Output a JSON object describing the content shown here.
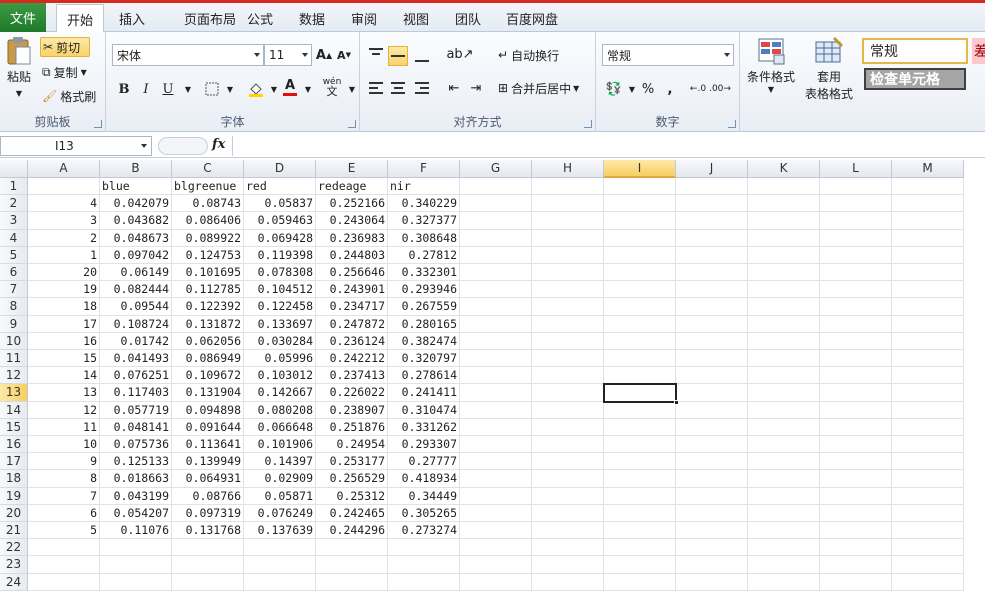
{
  "tabs": {
    "file": "文件",
    "items": [
      "开始",
      "插入",
      "页面布局",
      "公式",
      "数据",
      "审阅",
      "视图",
      "团队",
      "百度网盘"
    ]
  },
  "ribbon": {
    "clipboard": {
      "label": "剪贴板",
      "paste": "粘贴",
      "cut": "剪切",
      "copy": "复制",
      "format_painter": "格式刷"
    },
    "font": {
      "label": "字体",
      "name": "宋体",
      "size": "11",
      "bold": "B",
      "italic": "I",
      "underline": "U",
      "wen": "wén"
    },
    "alignment": {
      "label": "对齐方式",
      "wrap": "自动换行",
      "merge": "合并后居中"
    },
    "number": {
      "label": "数字",
      "format": "常规",
      "percent": "%",
      "comma": ","
    },
    "styles": {
      "conditional": "条件格式",
      "table_line1": "套用",
      "table_line2": "表格格式",
      "style_normal": "常规",
      "style_check": "检查单元格",
      "style_bad": "差"
    }
  },
  "formula_bar": {
    "name_box": "I13",
    "fx": "fx",
    "content": ""
  },
  "colors": {
    "accent_red": "#d52b1e",
    "file_green": "#2a8a35",
    "selection_gold": "#f7cf60"
  },
  "columns": [
    "A",
    "B",
    "C",
    "D",
    "E",
    "F",
    "G",
    "H",
    "I",
    "J",
    "K",
    "L",
    "M"
  ],
  "rows": [
    "1",
    "2",
    "3",
    "4",
    "5",
    "6",
    "7",
    "8",
    "9",
    "10",
    "11",
    "12",
    "13",
    "14",
    "15",
    "16",
    "17",
    "18",
    "19",
    "20",
    "21",
    "22",
    "23",
    "24"
  ],
  "sheet": {
    "header": [
      "",
      "blue",
      "blgreenue",
      "red",
      "redeage",
      "nir"
    ],
    "data": [
      [
        "4",
        "0.042079",
        "0.08743",
        "0.05837",
        "0.252166",
        "0.340229"
      ],
      [
        "3",
        "0.043682",
        "0.086406",
        "0.059463",
        "0.243064",
        "0.327377"
      ],
      [
        "2",
        "0.048673",
        "0.089922",
        "0.069428",
        "0.236983",
        "0.308648"
      ],
      [
        "1",
        "0.097042",
        "0.124753",
        "0.119398",
        "0.244803",
        "0.27812"
      ],
      [
        "20",
        "0.06149",
        "0.101695",
        "0.078308",
        "0.256646",
        "0.332301"
      ],
      [
        "19",
        "0.082444",
        "0.112785",
        "0.104512",
        "0.243901",
        "0.293946"
      ],
      [
        "18",
        "0.09544",
        "0.122392",
        "0.122458",
        "0.234717",
        "0.267559"
      ],
      [
        "17",
        "0.108724",
        "0.131872",
        "0.133697",
        "0.247872",
        "0.280165"
      ],
      [
        "16",
        "0.01742",
        "0.062056",
        "0.030284",
        "0.236124",
        "0.382474"
      ],
      [
        "15",
        "0.041493",
        "0.086949",
        "0.05996",
        "0.242212",
        "0.320797"
      ],
      [
        "14",
        "0.076251",
        "0.109672",
        "0.103012",
        "0.237413",
        "0.278614"
      ],
      [
        "13",
        "0.117403",
        "0.131904",
        "0.142667",
        "0.226022",
        "0.241411"
      ],
      [
        "12",
        "0.057719",
        "0.094898",
        "0.080208",
        "0.238907",
        "0.310474"
      ],
      [
        "11",
        "0.048141",
        "0.091644",
        "0.066648",
        "0.251876",
        "0.331262"
      ],
      [
        "10",
        "0.075736",
        "0.113641",
        "0.101906",
        "0.24954",
        "0.293307"
      ],
      [
        "9",
        "0.125133",
        "0.139949",
        "0.14397",
        "0.253177",
        "0.27777"
      ],
      [
        "8",
        "0.018663",
        "0.064931",
        "0.02909",
        "0.256529",
        "0.418934"
      ],
      [
        "7",
        "0.043199",
        "0.08766",
        "0.05871",
        "0.25312",
        "0.34449"
      ],
      [
        "6",
        "0.054207",
        "0.097319",
        "0.076249",
        "0.242465",
        "0.305265"
      ],
      [
        "5",
        "0.11076",
        "0.131768",
        "0.137639",
        "0.244296",
        "0.273274"
      ]
    ]
  },
  "selection": {
    "column": "I",
    "row": "13"
  }
}
